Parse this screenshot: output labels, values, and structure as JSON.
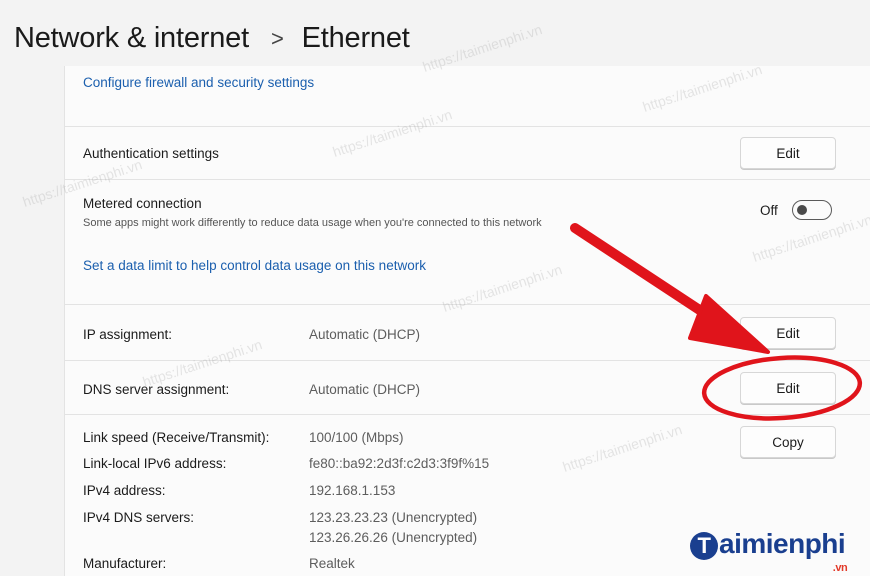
{
  "header": {
    "parent": "Network & internet",
    "separator": ">",
    "current": "Ethernet"
  },
  "links": {
    "firewall": "Configure firewall and security settings",
    "data_limit": "Set a data limit to help control data usage on this network"
  },
  "authentication": {
    "label": "Authentication settings",
    "button": "Edit"
  },
  "metered": {
    "label": "Metered connection",
    "description": "Some apps might work differently to reduce data usage when you're connected to this network",
    "state": "Off",
    "on": false
  },
  "ip_assignment": {
    "label": "IP assignment:",
    "value": "Automatic (DHCP)",
    "button": "Edit"
  },
  "dns_assignment": {
    "label": "DNS server assignment:",
    "value": "Automatic (DHCP)",
    "button": "Edit"
  },
  "properties": {
    "copy_button": "Copy",
    "link_speed_label": "Link speed (Receive/Transmit):",
    "link_speed_value": "100/100 (Mbps)",
    "ipv6_label": "Link-local IPv6 address:",
    "ipv6_value": "fe80::ba92:2d3f:c2d3:3f9f%15",
    "ipv4_label": "IPv4 address:",
    "ipv4_value": "192.168.1.153",
    "dns_label": "IPv4 DNS servers:",
    "dns_value_1": "123.23.23.23 (Unencrypted)",
    "dns_value_2": "123.26.26.26 (Unencrypted)",
    "manufacturer_label": "Manufacturer:",
    "manufacturer_value": "Realtek"
  },
  "annotation": {
    "color": "#e0141b"
  },
  "watermark_text": "https://taimienphi.vn",
  "logo": {
    "text": "aimienphi",
    "initial": "T",
    "suffix": ".vn"
  }
}
